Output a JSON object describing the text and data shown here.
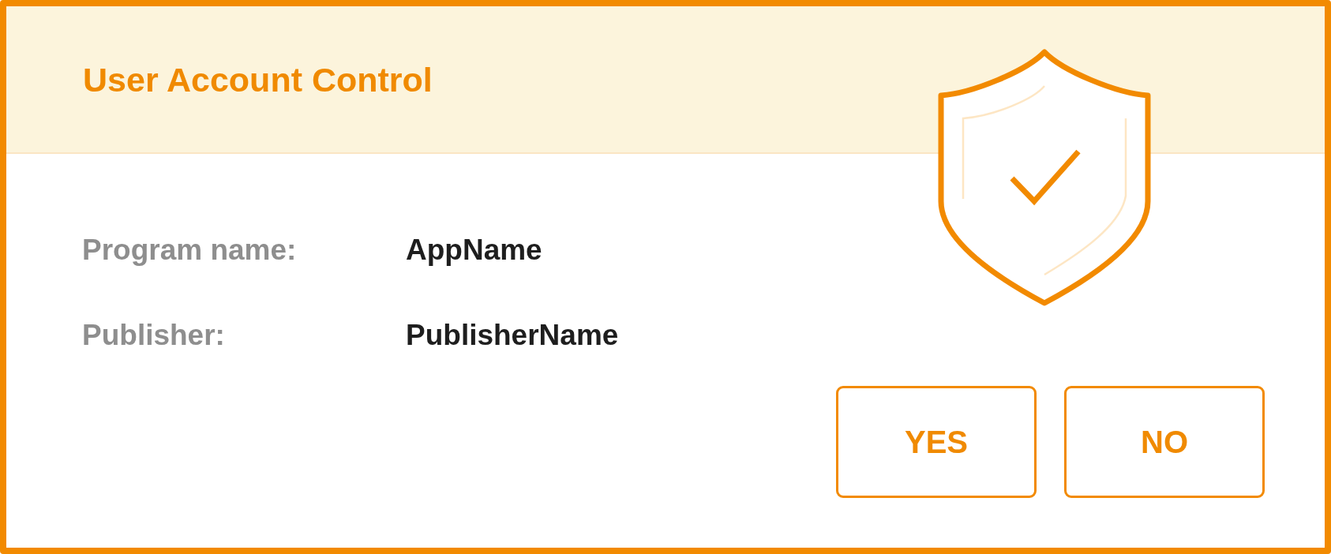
{
  "window": {
    "title": "User Account Control"
  },
  "fields": [
    {
      "label": "Program name:",
      "value": "AppName"
    },
    {
      "label": "Publisher:",
      "value": "PublisherName"
    }
  ],
  "buttons": [
    {
      "label": "YES"
    },
    {
      "label": "NO"
    }
  ]
}
